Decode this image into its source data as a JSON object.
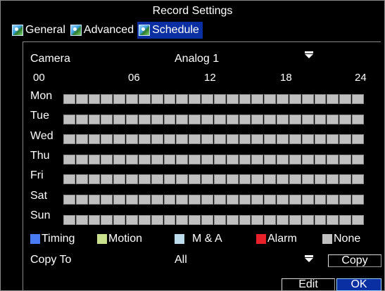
{
  "window": {
    "title": "Record Settings"
  },
  "tabs": [
    {
      "label": "General",
      "icon": "settings-tab-icon",
      "active": false
    },
    {
      "label": "Advanced",
      "icon": "settings-tab-icon",
      "active": false
    },
    {
      "label": "Schedule",
      "icon": "settings-tab-icon",
      "active": true
    }
  ],
  "camera": {
    "label": "Camera",
    "value": "Analog 1",
    "icon": "dropdown-arrow-icon"
  },
  "timeline": {
    "hours": [
      "00",
      "06",
      "12",
      "18",
      "24"
    ]
  },
  "schedule": {
    "days": [
      "Mon",
      "Tue",
      "Wed",
      "Thu",
      "Fri",
      "Sat",
      "Sun"
    ],
    "slots_per_day": 24,
    "fill_color": "#c0c0c0",
    "border_color": "#8d8d8d"
  },
  "legend": [
    {
      "label": "Timing",
      "color": "#4a7bf5"
    },
    {
      "label": "Motion",
      "color": "#c8e08c"
    },
    {
      "label": "M & A",
      "color": "#bcdcec"
    },
    {
      "label": "Alarm",
      "color": "#e8202a"
    },
    {
      "label": "None",
      "color": "#c0c0c0"
    }
  ],
  "copy_to": {
    "label": "Copy To",
    "value": "All",
    "copy_button": "Copy"
  },
  "buttons": {
    "edit": "Edit",
    "ok": "OK"
  },
  "colors": {
    "active_tab": "#0a2fa3",
    "ok_button": "#0a2fa3"
  }
}
